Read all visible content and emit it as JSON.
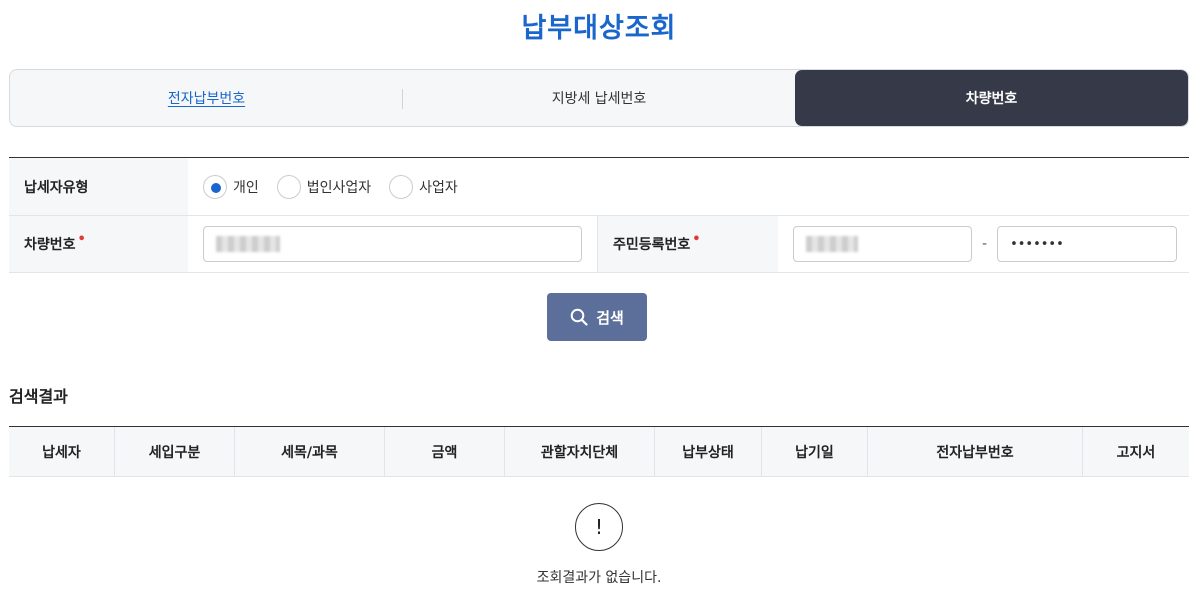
{
  "page": {
    "title": "납부대상조회"
  },
  "tabs": [
    {
      "label": "전자납부번호",
      "active": false
    },
    {
      "label": "지방세 납세번호",
      "active": false
    },
    {
      "label": "차량번호",
      "active": true
    }
  ],
  "form": {
    "taxpayer_type_label": "납세자유형",
    "radio_options": [
      {
        "label": "개인",
        "checked": true
      },
      {
        "label": "법인사업자",
        "checked": false
      },
      {
        "label": "사업자",
        "checked": false
      }
    ],
    "vehicle_label": "차량번호",
    "resident_label": "주민등록번호",
    "required_mark": "•",
    "resident_separator": "-",
    "resident_back_value": "•••••••"
  },
  "search": {
    "label": "검색",
    "icon": "search-icon"
  },
  "results": {
    "title": "검색결과",
    "columns": [
      "납세자",
      "세입구분",
      "세목/과목",
      "금액",
      "관할자치단체",
      "납부상태",
      "납기일",
      "전자납부번호",
      "고지서"
    ],
    "empty_icon_glyph": "!",
    "empty_message": "조회결과가 없습니다."
  },
  "colors": {
    "title": "#1a66cc",
    "active_tab": "#363a48",
    "search_button": "#5c6e9a",
    "required": "#e23a3a",
    "radio_checked": "#1a66cc"
  }
}
